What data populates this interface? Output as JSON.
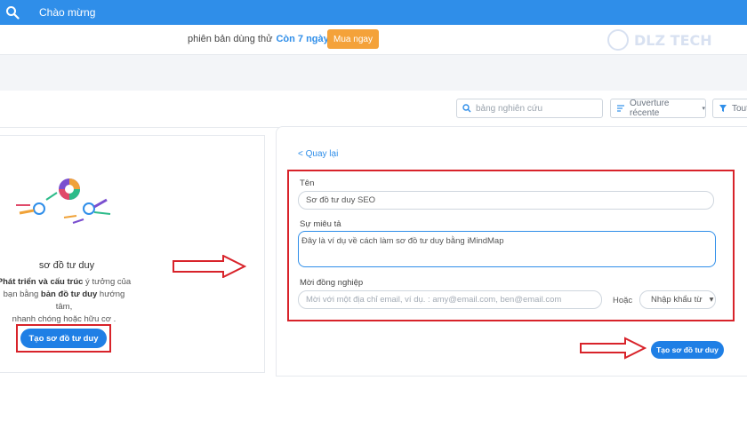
{
  "topbar": {
    "title": "Chào mừng",
    "search_icon": "search-icon",
    "color": "#2f8ee9"
  },
  "trial": {
    "text": "phiên bản dùng thử",
    "days": "Còn 7 ngày",
    "buy_label": "Mua ngay",
    "buy_color": "#f4a23a"
  },
  "watermark": {
    "text": "DLZ TECH"
  },
  "toolbar": {
    "search_placeholder": "bảng nghiên cứu",
    "sort_label": "Ouverture récente",
    "filter_label": "Tout"
  },
  "left_panel": {
    "title": "sơ đồ tư duy",
    "desc_bold_1": "Phát triển và cấu trúc",
    "desc_text_1": " ý tưởng của",
    "desc_text_2": "bạn bằng ",
    "desc_bold_2": "bản đồ tư duy",
    "desc_text_3": " hướng tâm,",
    "desc_text_4": "nhanh chóng hoặc hữu cơ .",
    "create_label": "Tạo sơ đồ tư duy"
  },
  "form": {
    "back_label": "< Quay lại",
    "name_label": "Tên",
    "name_value": "Sơ đồ tư duy SEO",
    "desc_label": "Sự miêu tả",
    "desc_value": "Đây là ví dụ về cách làm sơ đồ tư duy bằng iMindMap",
    "invite_label": "Mời đồng nghiệp",
    "invite_placeholder": "Mời với một địa chỉ email, ví dụ. : amy@email.com, ben@email.com",
    "or_label": "Hoặc",
    "import_label": "Nhập khẩu từ",
    "create_label": "Tạo sơ đồ tư duy"
  },
  "colors": {
    "accent": "#1f7fe5",
    "highlight_box": "#d8232a"
  }
}
